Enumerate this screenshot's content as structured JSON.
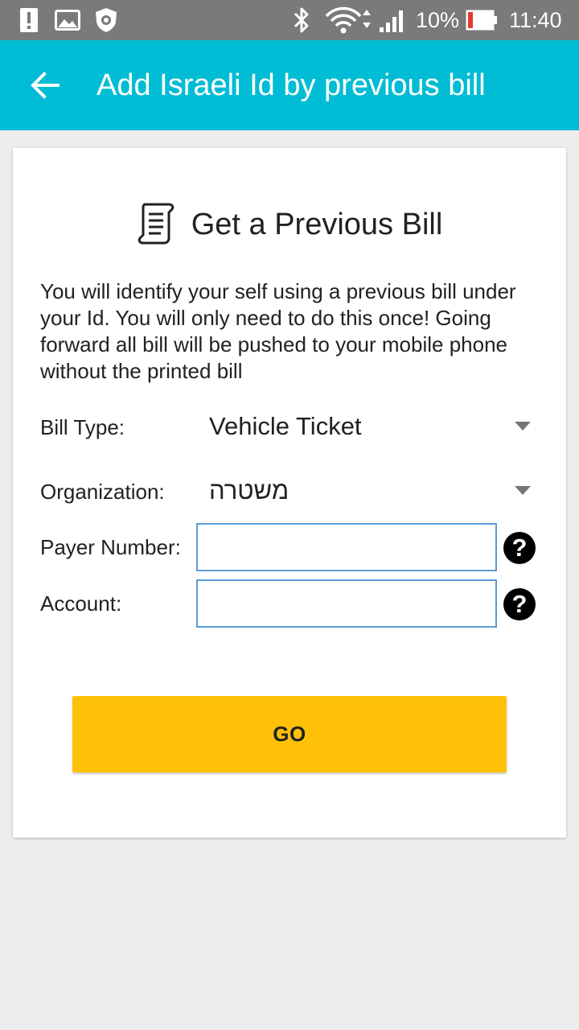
{
  "status_bar": {
    "battery_percent": "10%",
    "time": "11:40",
    "icons": [
      "alert-icon",
      "image-icon",
      "shield-icon",
      "bluetooth-icon",
      "wifi-icon",
      "signal-icon",
      "battery-icon"
    ]
  },
  "app_bar": {
    "back_icon": "arrow-left-icon",
    "title": "Add Israeli Id by previous bill",
    "color": "#00bcd4"
  },
  "card": {
    "icon": "document-icon",
    "title": "Get a Previous Bill",
    "description": "You will identify your self using a previous bill under your Id. You will only need to do this once! Going forward all bill will be pushed to your mobile phone without the printed bill"
  },
  "form": {
    "bill_type_label": "Bill Type:",
    "bill_type_value": "Vehicle Ticket",
    "organization_label": "Organization:",
    "organization_value": "משטרה",
    "payer_number_label": "Payer Number:",
    "payer_number_value": "",
    "account_label": "Account:",
    "account_value": "",
    "help_glyph": "?"
  },
  "go_button": {
    "label": "GO",
    "color": "#ffc107"
  }
}
